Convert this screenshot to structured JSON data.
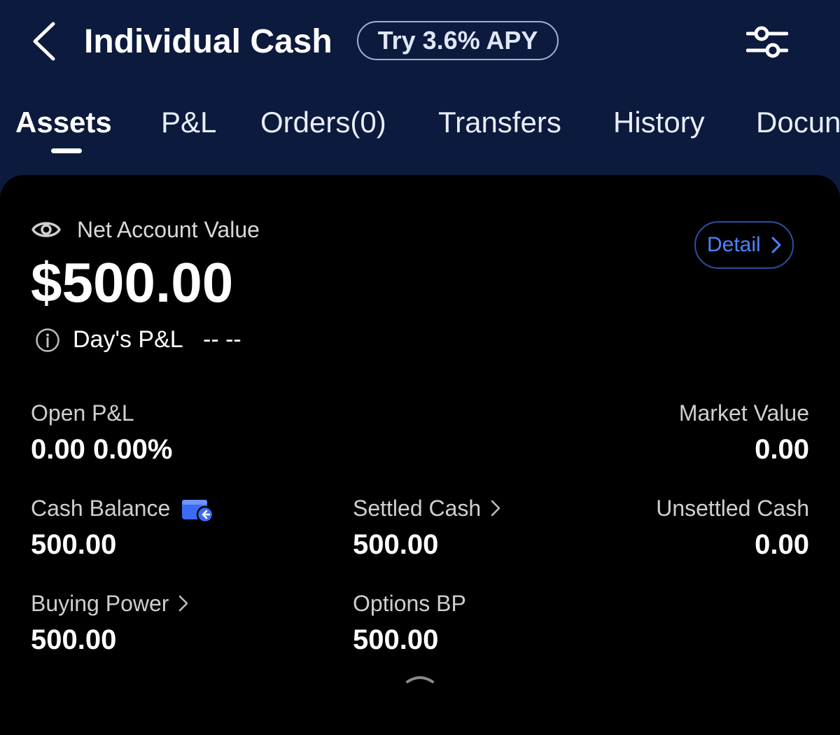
{
  "header": {
    "title": "Individual Cash",
    "apy_badge": "Try 3.6% APY",
    "icons": {
      "back": "chevron-left-icon",
      "filter": "sliders-icon"
    }
  },
  "tabs": [
    {
      "label": "Assets",
      "active": true
    },
    {
      "label": "P&L",
      "active": false
    },
    {
      "label": "Orders(0)",
      "active": false
    },
    {
      "label": "Transfers",
      "active": false
    },
    {
      "label": "History",
      "active": false
    },
    {
      "label": "Docun",
      "active": false
    }
  ],
  "account": {
    "net_label": "Net Account Value",
    "net_value": "$500.00",
    "detail_label": "Detail",
    "days_pl_label": "Day's P&L",
    "days_pl_value": "-- --"
  },
  "metrics": {
    "open_pl": {
      "label": "Open P&L",
      "value": "0.00 0.00%"
    },
    "market_value": {
      "label": "Market Value",
      "value": "0.00"
    },
    "cash_balance": {
      "label": "Cash Balance",
      "value": "500.00"
    },
    "settled_cash": {
      "label": "Settled Cash",
      "value": "500.00"
    },
    "unsettled_cash": {
      "label": "Unsettled Cash",
      "value": "0.00"
    },
    "buying_power": {
      "label": "Buying Power",
      "value": "500.00"
    },
    "options_bp": {
      "label": "Options BP",
      "value": "500.00"
    }
  },
  "colors": {
    "header_bg": "#0c1a3d",
    "card_bg": "#000000",
    "accent_blue": "#4f82ff",
    "wallet_blue": "#3b6cf6"
  }
}
